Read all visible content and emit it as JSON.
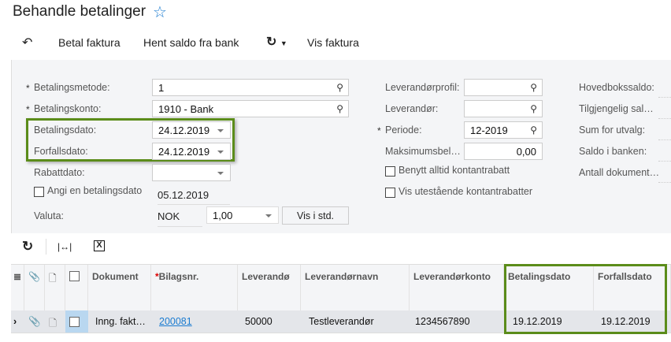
{
  "title": "Behandle betalinger",
  "toolbar": {
    "pay_invoice": "Betal faktura",
    "fetch_balance": "Hent saldo fra bank",
    "show_invoice": "Vis faktura"
  },
  "form": {
    "betalingsmetode": {
      "label": "Betalingsmetode:",
      "value": "1"
    },
    "betalingskonto": {
      "label": "Betalingskonto:",
      "value": "1910 - Bank"
    },
    "betalingsdato": {
      "label": "Betalingsdato:",
      "value": "24.12.2019"
    },
    "forfallsdato": {
      "label": "Forfallsdato:",
      "value": "24.12.2019"
    },
    "rabattdato": {
      "label": "Rabattdato:",
      "value": ""
    },
    "angi": {
      "label": "Angi en betalingsdato",
      "value": "05.12.2019"
    },
    "valuta": {
      "label": "Valuta:",
      "currency": "NOK",
      "rate": "1,00",
      "button": "Vis i std."
    },
    "leverandorprofil": {
      "label": "Leverandørprofil:"
    },
    "leverandor": {
      "label": "Leverandør:"
    },
    "periode": {
      "label": "Periode:",
      "value": "12-2019"
    },
    "maksimum": {
      "label": "Maksimumsbel…",
      "value": "0,00"
    },
    "benytt": {
      "label": "Benytt alltid kontantrabatt"
    },
    "vis_utestaende": {
      "label": "Vis utestående kontantrabatter"
    },
    "summary": [
      "Hovedbokssaldo:",
      "Tilgjengelig sal…",
      "Sum for utvalg:",
      "Saldo i banken:",
      "Antall dokument…"
    ]
  },
  "grid": {
    "headers": [
      "Dokument",
      "Bilagsnr.",
      "Leverandø",
      "Leverandørnavn",
      "Leverandørkonto",
      "Betalingsdato",
      "Forfallsdato"
    ],
    "rows": [
      [
        "Inng. fakt…",
        "200081",
        "50000",
        "Testleverandør",
        "1234567890",
        "19.12.2019",
        "19.12.2019"
      ]
    ]
  }
}
